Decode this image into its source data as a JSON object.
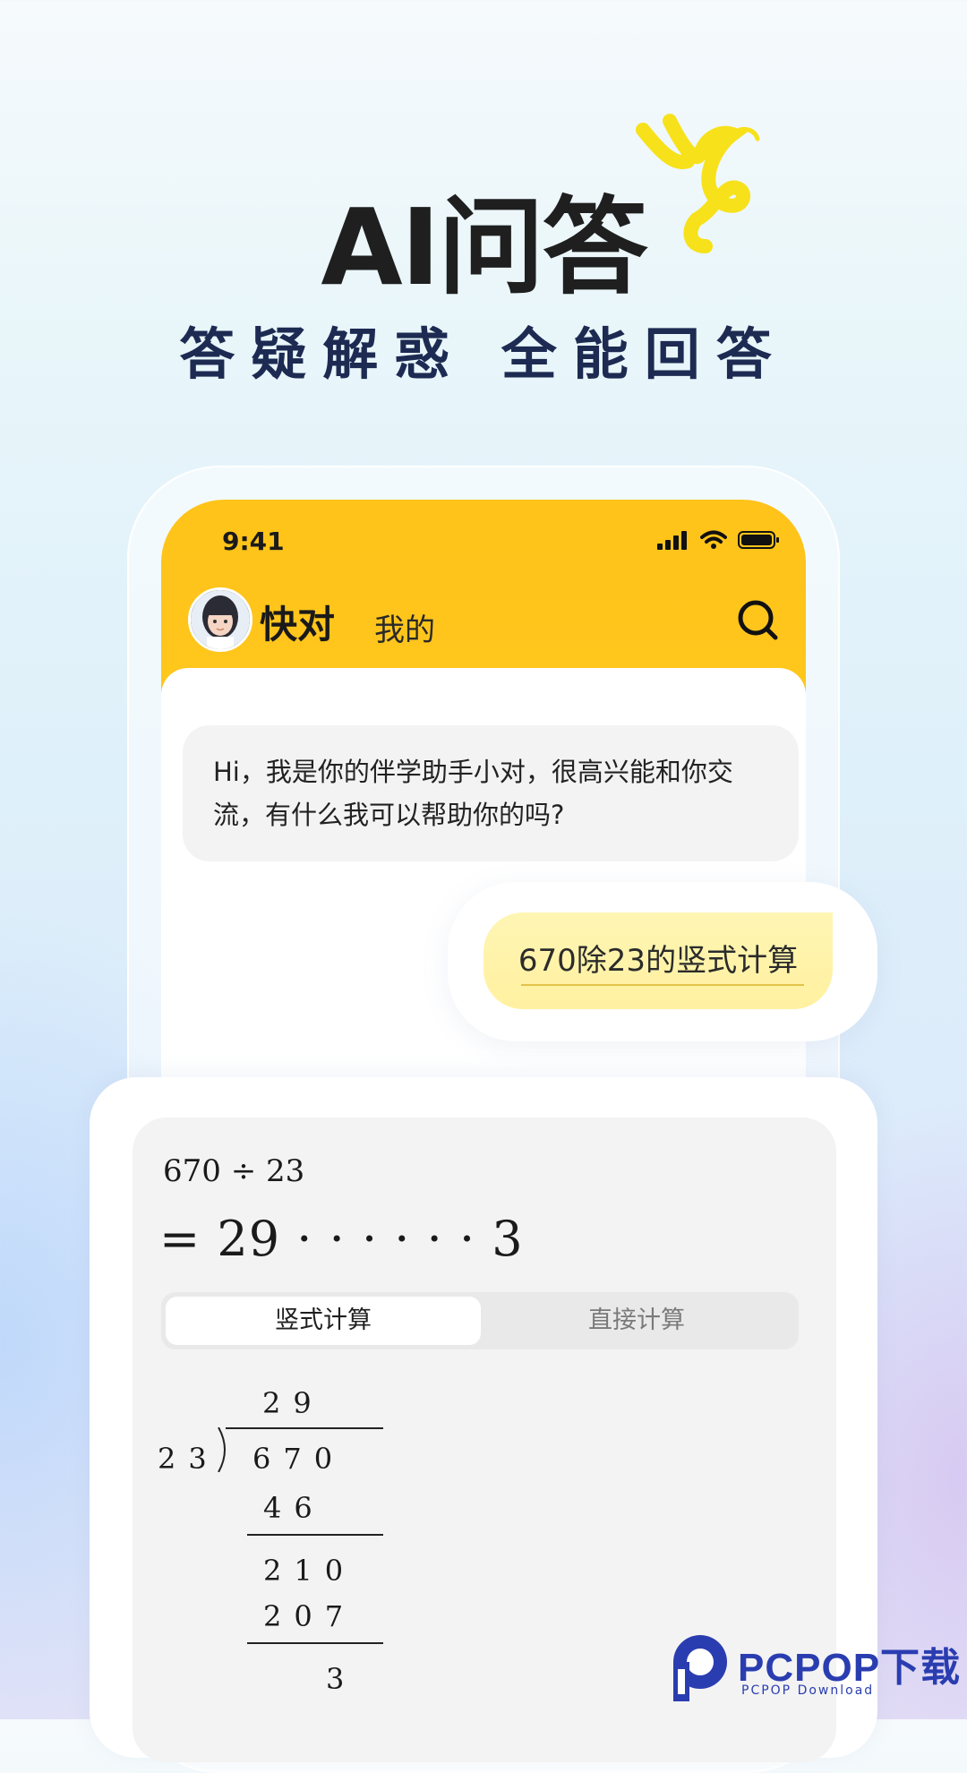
{
  "hero": {
    "title": "AI问答",
    "subtitle": "答疑解惑 全能回答"
  },
  "status_bar": {
    "time": "9:41"
  },
  "header": {
    "app_name": "快对",
    "tab_mine": "我的"
  },
  "chat": {
    "bot_message": "Hi，我是你的伴学助手小对，很高兴能和你交流，有什么我可以帮助你的吗?",
    "user_message": "670除23的竖式计算"
  },
  "answer": {
    "expression": "670 ÷ 23",
    "result": "= 29 · · · · · · 3",
    "tabs": [
      "竖式计算",
      "直接计算"
    ],
    "active_tab": "竖式计算",
    "long_division": {
      "quotient": "29",
      "divisor": "23",
      "dividend": "670",
      "step1": "46",
      "step2": "210",
      "step3": "207",
      "remainder": "3"
    }
  },
  "watermark": {
    "brand": "PCPOP下载",
    "sub": "PCPOP Download"
  },
  "colors": {
    "header_yellow": "#ffc31a",
    "user_bubble": "#fff3a8",
    "title_dark": "#1f1f1f",
    "subtitle_navy": "#1d2a52",
    "watermark_blue": "#2a3db0"
  },
  "icons": [
    "signal-icon",
    "wifi-icon",
    "battery-icon",
    "search-icon",
    "scribble-decoration"
  ]
}
